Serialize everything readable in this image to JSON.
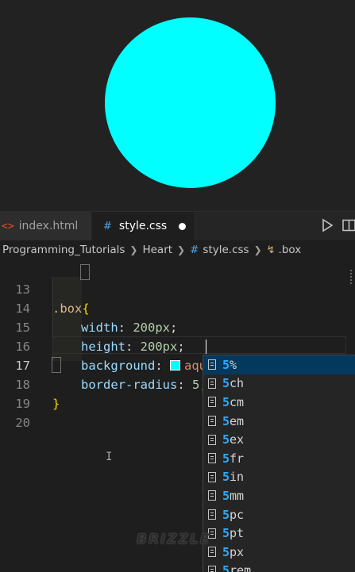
{
  "preview": {
    "box_color": "#00ffff"
  },
  "tabs": [
    {
      "icon": "<>",
      "label": "index.html"
    },
    {
      "icon": "#",
      "label": "style.css"
    }
  ],
  "breadcrumb": [
    "Programming_Tutorials",
    "Heart",
    "style.css",
    ".box"
  ],
  "code": {
    "line_numbers": [
      "13",
      "14",
      "15",
      "16",
      "17",
      "18",
      "19",
      "20"
    ],
    "selector": ".box",
    "open_brace": "{",
    "close_brace": "}",
    "lines": [
      {
        "prop": "width",
        "colon": ": ",
        "value": "200px",
        "end": ";"
      },
      {
        "prop": "height",
        "colon": ": ",
        "value": "200px",
        "end": ";"
      },
      {
        "prop": "background",
        "colon": ": ",
        "value": "aqua",
        "end": ";"
      },
      {
        "prop": "border-radius",
        "colon": ": ",
        "value": "5",
        "end": ";"
      }
    ]
  },
  "suggestions": {
    "typed": "5",
    "items": [
      "%",
      "ch",
      "cm",
      "em",
      "ex",
      "fr",
      "in",
      "mm",
      "pc",
      "pt",
      "px",
      "rem"
    ]
  },
  "watermark": "BRIZZLE"
}
